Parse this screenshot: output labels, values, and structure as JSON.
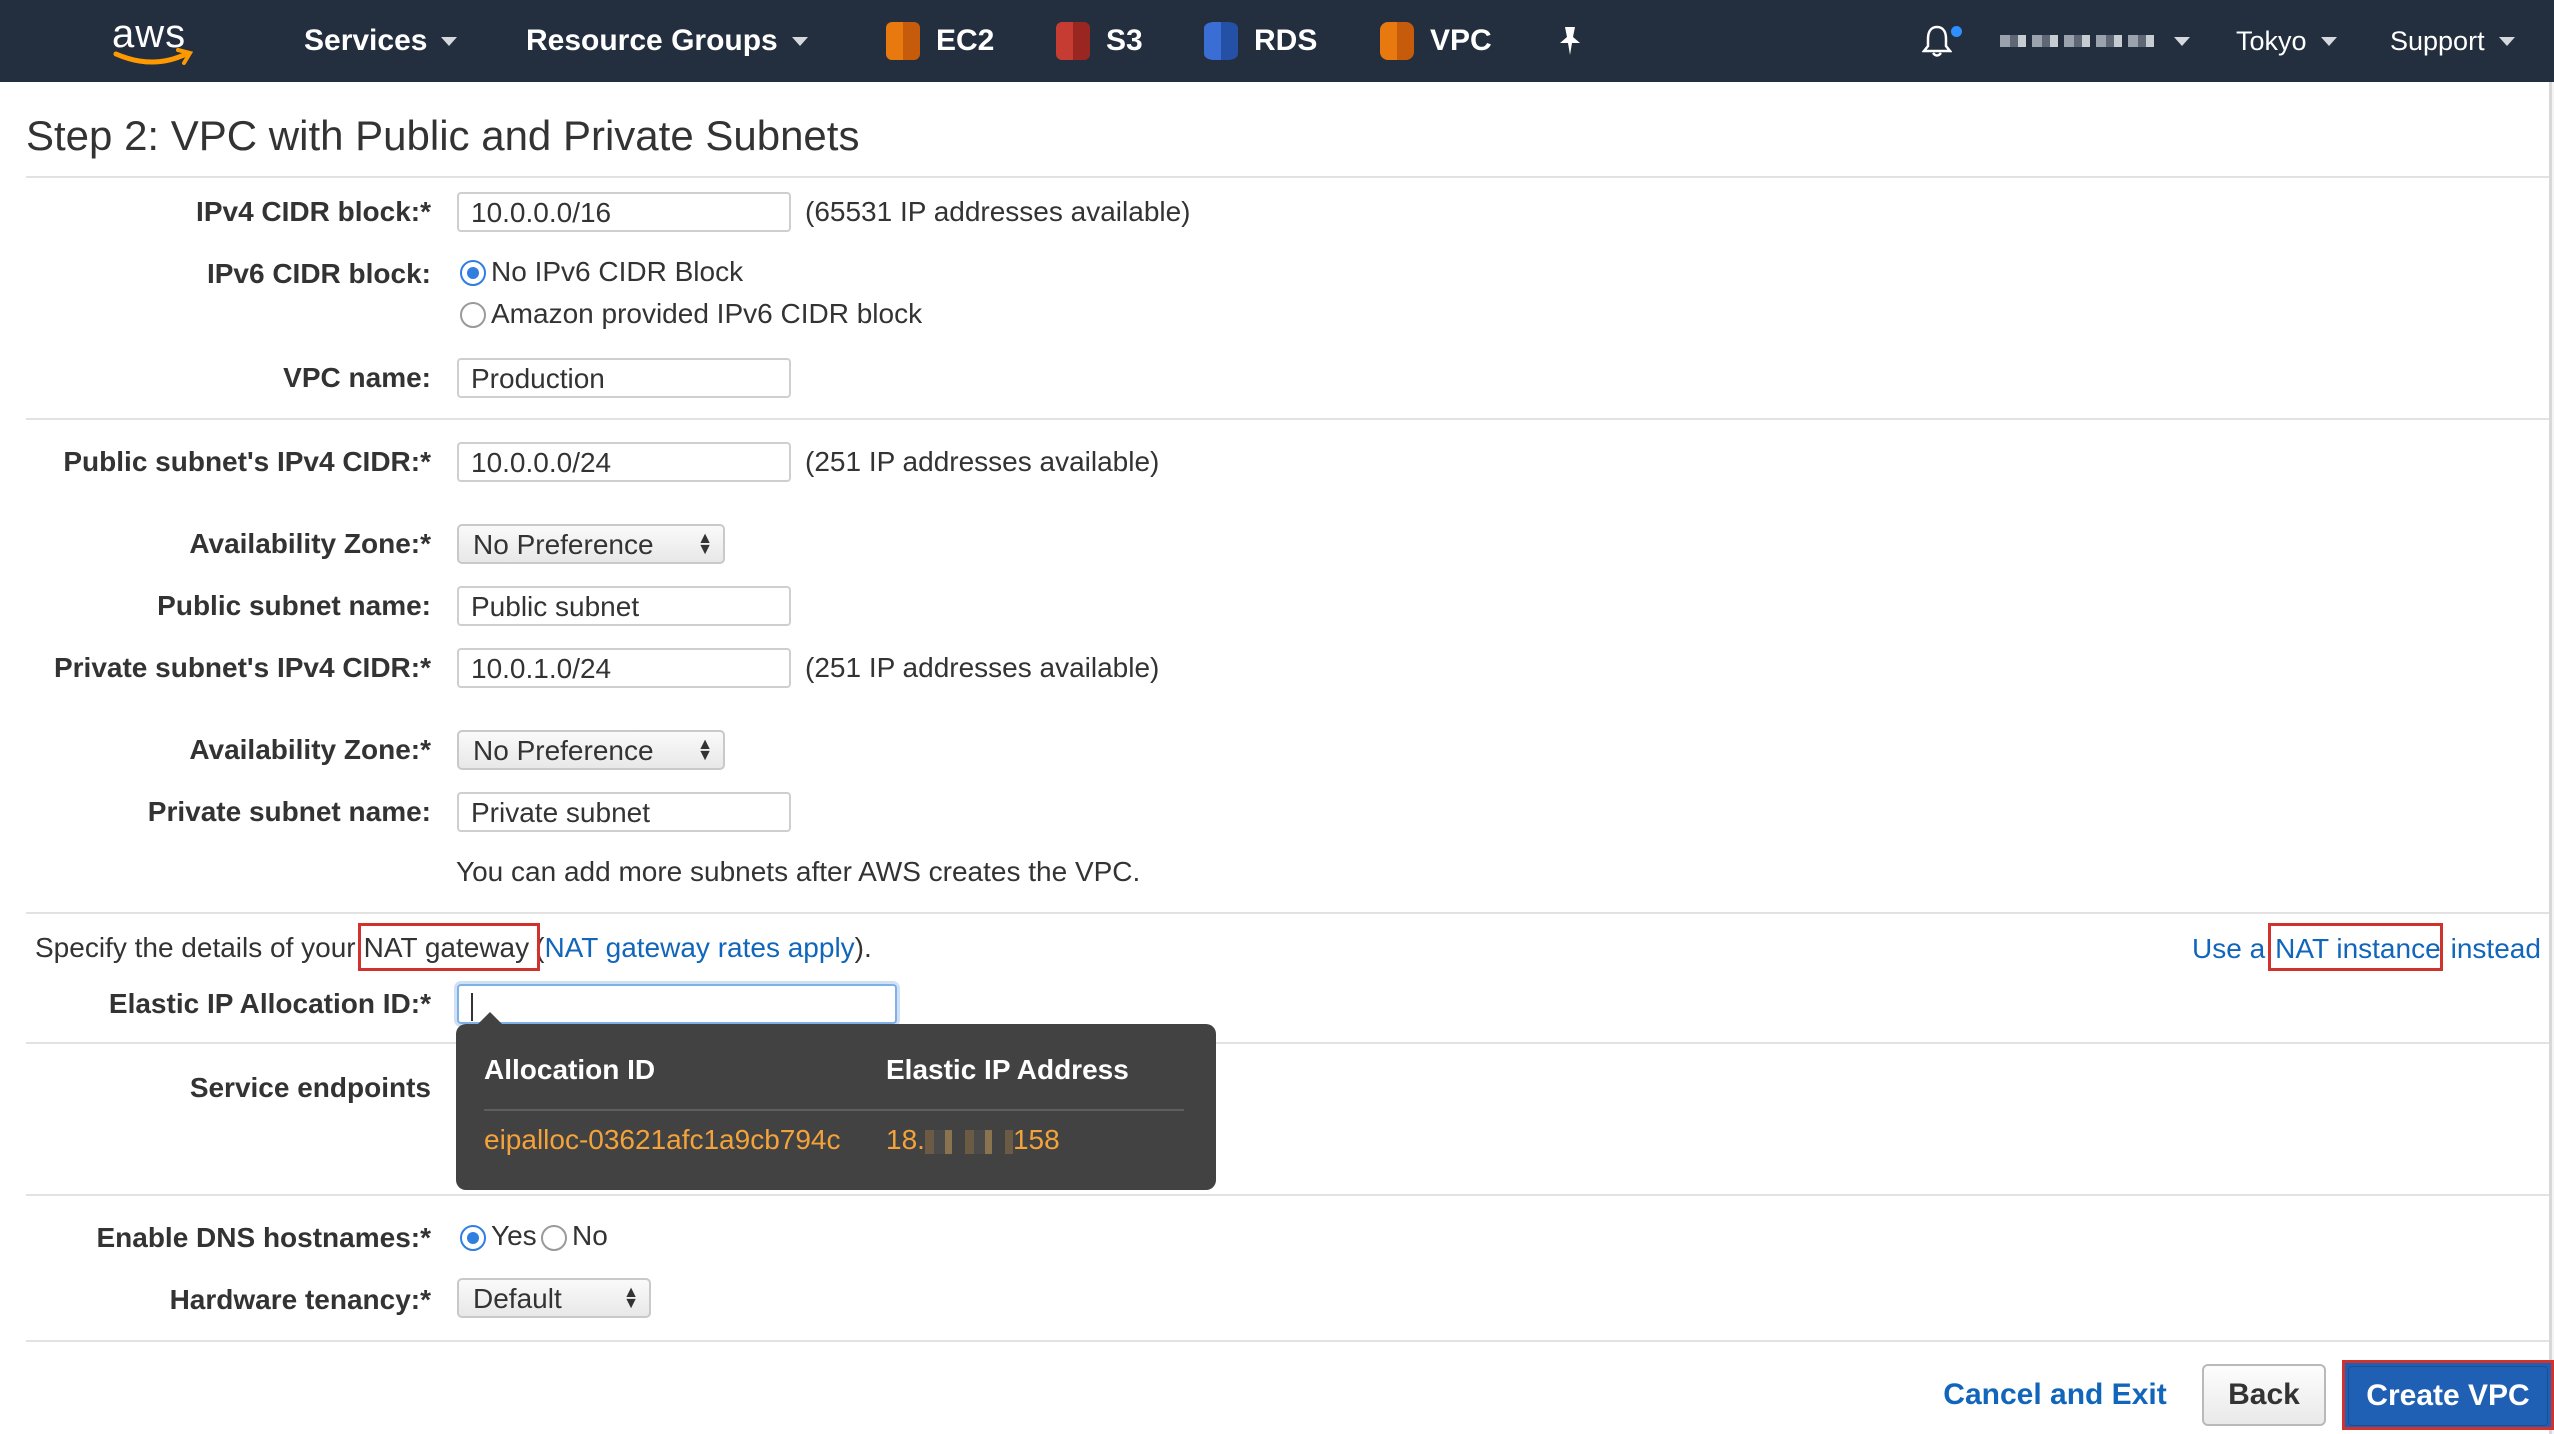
{
  "nav": {
    "logo": "aws",
    "services": "Services",
    "resource_groups": "Resource Groups",
    "shortcuts": [
      {
        "label": "EC2",
        "icon": "ec2-icon"
      },
      {
        "label": "S3",
        "icon": "s3-icon"
      },
      {
        "label": "RDS",
        "icon": "rds-icon"
      },
      {
        "label": "VPC",
        "icon": "vpc-icon"
      }
    ],
    "region": "Tokyo",
    "support": "Support"
  },
  "page": {
    "title": "Step 2: VPC with Public and Private Subnets"
  },
  "form": {
    "ipv4_cidr": {
      "label": "IPv4 CIDR block:*",
      "value": "10.0.0.0/16",
      "help": "(65531 IP addresses available)"
    },
    "ipv6_cidr": {
      "label": "IPv6 CIDR block:",
      "options": [
        "No IPv6 CIDR Block",
        "Amazon provided IPv6 CIDR block"
      ],
      "selected": "No IPv6 CIDR Block"
    },
    "vpc_name": {
      "label": "VPC name:",
      "value": "Production"
    },
    "public_subnet_cidr": {
      "label": "Public subnet's IPv4 CIDR:*",
      "value": "10.0.0.0/24",
      "help": "(251 IP addresses available)"
    },
    "public_az": {
      "label": "Availability Zone:*",
      "value": "No Preference"
    },
    "public_subnet_name": {
      "label": "Public subnet name:",
      "value": "Public subnet"
    },
    "private_subnet_cidr": {
      "label": "Private subnet's IPv4 CIDR:*",
      "value": "10.0.1.0/24",
      "help": "(251 IP addresses available)"
    },
    "private_az": {
      "label": "Availability Zone:*",
      "value": "No Preference"
    },
    "private_subnet_name": {
      "label": "Private subnet name:",
      "value": "Private subnet"
    },
    "subnet_note": "You can add more subnets after AWS creates the VPC.",
    "nat": {
      "prefix": "Specify the details of your",
      "gateway_label": "NAT gateway",
      "open_paren": "(",
      "rates_link": "NAT gateway rates apply",
      "close": ").",
      "use_a": "Use a",
      "instance_link": "NAT instance",
      "instead": "instead"
    },
    "elastic_ip": {
      "label": "Elastic IP Allocation ID:*",
      "value": ""
    },
    "service_endpoints": {
      "label": "Service endpoints"
    },
    "dns_hostnames": {
      "label": "Enable DNS hostnames:*",
      "options": [
        "Yes",
        "No"
      ],
      "selected": "Yes"
    },
    "tenancy": {
      "label": "Hardware tenancy:*",
      "value": "Default"
    }
  },
  "popup": {
    "col_allocation": "Allocation ID",
    "col_address": "Elastic IP Address",
    "rows": [
      {
        "allocation_id": "eipalloc-03621afc1a9cb794c",
        "address_prefix": "18.",
        "address_suffix": "158"
      }
    ]
  },
  "buttons": {
    "cancel": "Cancel and Exit",
    "back": "Back",
    "create": "Create VPC"
  },
  "colors": {
    "nav_bg": "#232f3e",
    "link": "#1166bb",
    "primary": "#1f5fb4",
    "highlight": "#d0322e",
    "popup_value": "#f3a33a"
  }
}
